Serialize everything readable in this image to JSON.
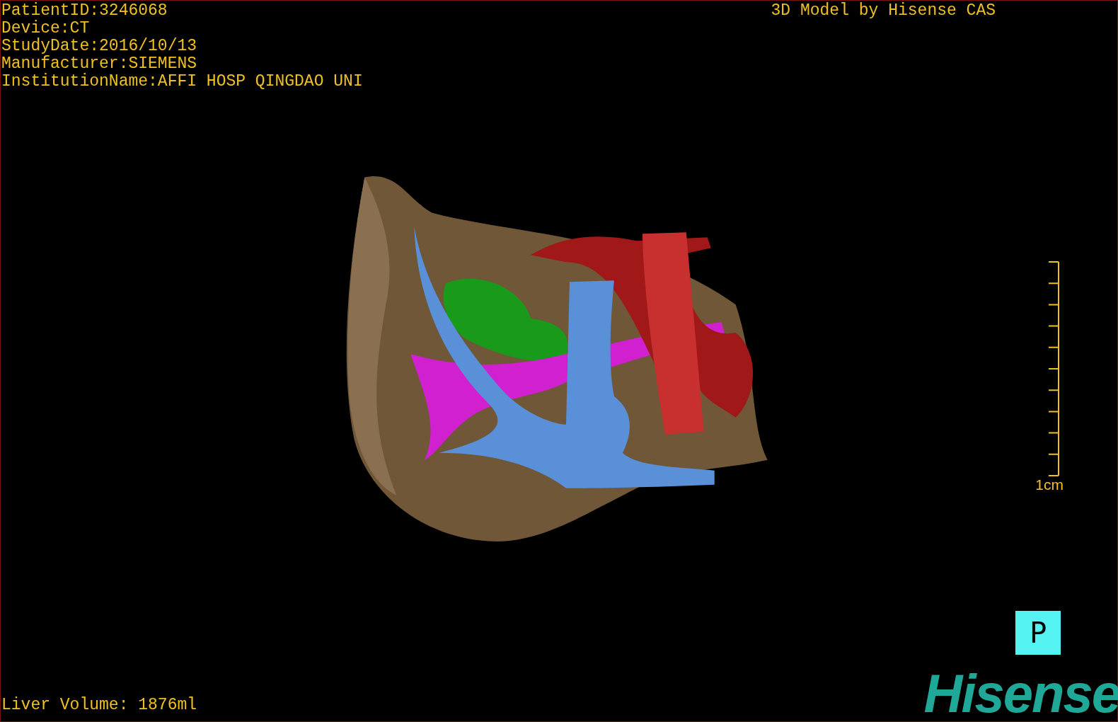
{
  "patient_info": [
    "PatientID:3246068",
    "Device:CT",
    "StudyDate:2016/10/13",
    "Manufacturer:SIEMENS",
    "InstitutionName:AFFI HOSP QINGDAO UNI"
  ],
  "title": "3D Model by Hisense CAS",
  "scale_bar": {
    "label": "1cm"
  },
  "orientation_marker": "P",
  "liver_volume": "Liver Volume: 1876ml",
  "logo": "Hisense"
}
